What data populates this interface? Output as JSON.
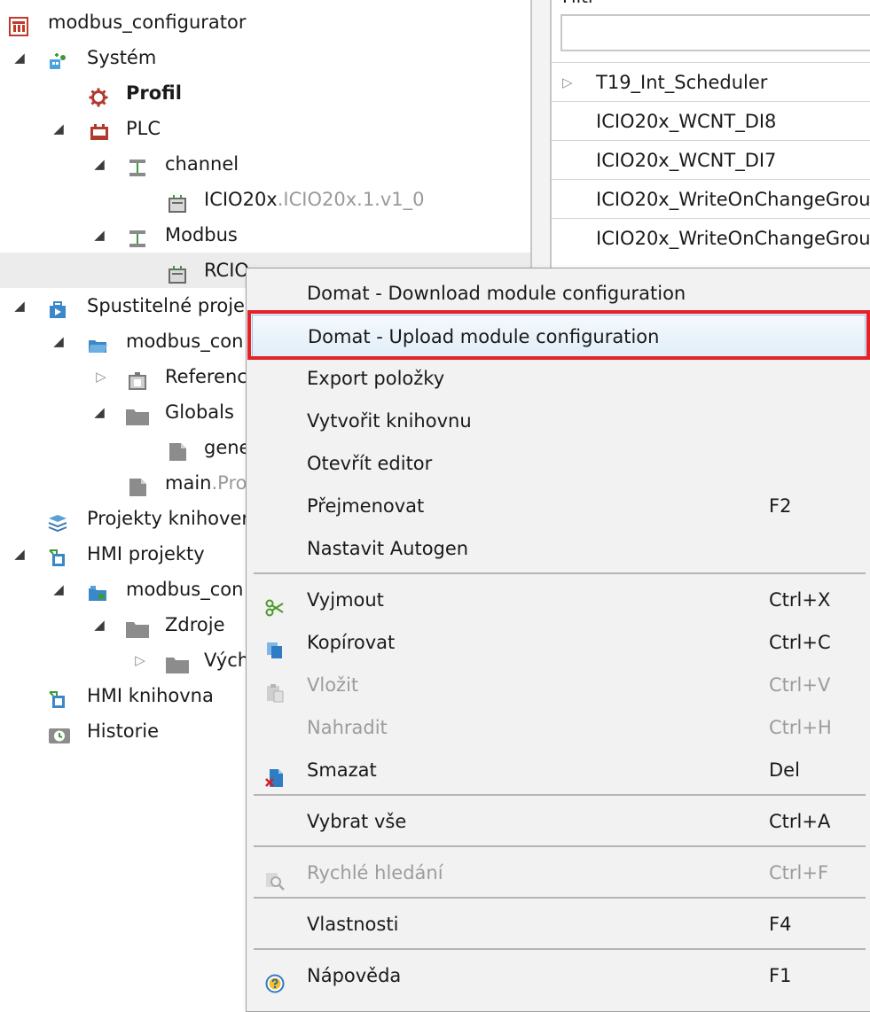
{
  "tree": {
    "items": [
      {
        "label": "modbus_configurator",
        "suffix": "",
        "bold": false,
        "icon": "project-root-icon"
      },
      {
        "label": "Systém",
        "suffix": "",
        "bold": false,
        "icon": "system-icon"
      },
      {
        "label": "Profil",
        "suffix": "",
        "bold": true,
        "icon": "gear-icon"
      },
      {
        "label": "PLC",
        "suffix": "",
        "bold": false,
        "icon": "plc-icon"
      },
      {
        "label": "channel",
        "suffix": "",
        "bold": false,
        "icon": "channel-icon"
      },
      {
        "label": "ICIO20x",
        "suffix": ".ICIO20x.1.v1_0",
        "bold": false,
        "icon": "module-icon"
      },
      {
        "label": "Modbus",
        "suffix": "",
        "bold": false,
        "icon": "channel-icon"
      },
      {
        "label": "RCIO",
        "suffix": "...",
        "bold": false,
        "icon": "module-icon"
      },
      {
        "label": "Spustitelné proje",
        "suffix": "",
        "bold": false,
        "icon": "executable-projects-icon"
      },
      {
        "label": "modbus_con",
        "suffix": "",
        "bold": false,
        "icon": "open-folder-icon"
      },
      {
        "label": "Referenc",
        "suffix": "",
        "bold": false,
        "icon": "references-icon"
      },
      {
        "label": "Globals",
        "suffix": "",
        "bold": false,
        "icon": "folder-icon"
      },
      {
        "label": "gene",
        "suffix": "",
        "bold": false,
        "icon": "file-icon"
      },
      {
        "label": "main",
        "suffix": ".Pro",
        "bold": false,
        "icon": "file-icon"
      },
      {
        "label": "Projekty knihover",
        "suffix": "",
        "bold": false,
        "icon": "library-icon"
      },
      {
        "label": "HMI projekty",
        "suffix": "",
        "bold": false,
        "icon": "hmi-icon"
      },
      {
        "label": "modbus_con",
        "suffix": "",
        "bold": false,
        "icon": "hmi-project-icon"
      },
      {
        "label": "Zdroje",
        "suffix": "",
        "bold": false,
        "icon": "folder-icon"
      },
      {
        "label": "Vých",
        "suffix": "",
        "bold": false,
        "icon": "folder-icon"
      },
      {
        "label": "HMI knihovna",
        "suffix": "",
        "bold": false,
        "icon": "hmi-icon"
      },
      {
        "label": "Historie",
        "suffix": "",
        "bold": false,
        "icon": "history-icon"
      }
    ]
  },
  "right_panel": {
    "filter_label": "Filtr",
    "filter_value": "",
    "items": [
      {
        "label": "T19_Int_Scheduler",
        "expandable": true
      },
      {
        "label": "ICIO20x_WCNT_DI8",
        "expandable": false
      },
      {
        "label": "ICIO20x_WCNT_DI7",
        "expandable": false
      },
      {
        "label": "ICIO20x_WriteOnChangeGrou",
        "expandable": false
      },
      {
        "label": "ICIO20x_WriteOnChangeGrou",
        "expandable": false
      }
    ]
  },
  "context_menu": {
    "items": [
      {
        "label": "Domat - Download module configuration",
        "shortcut": "",
        "icon": "",
        "disabled": false
      },
      {
        "label": "Domat - Upload module configuration",
        "shortcut": "",
        "icon": "",
        "disabled": false,
        "highlighted": true
      },
      {
        "label": "Export položky",
        "shortcut": "",
        "icon": "",
        "disabled": false
      },
      {
        "label": "Vytvořit knihovnu",
        "shortcut": "",
        "icon": "",
        "disabled": false
      },
      {
        "label": "Otevřít editor",
        "shortcut": "",
        "icon": "",
        "disabled": false
      },
      {
        "label": "Přejmenovat",
        "shortcut": "F2",
        "icon": "",
        "disabled": false
      },
      {
        "label": "Nastavit Autogen",
        "shortcut": "",
        "icon": "",
        "disabled": false
      },
      {
        "label": "Vyjmout",
        "shortcut": "Ctrl+X",
        "icon": "scissors-icon",
        "disabled": false
      },
      {
        "label": "Kopírovat",
        "shortcut": "Ctrl+C",
        "icon": "copy-icon",
        "disabled": false
      },
      {
        "label": "Vložit",
        "shortcut": "Ctrl+V",
        "icon": "paste-icon",
        "disabled": true
      },
      {
        "label": "Nahradit",
        "shortcut": "Ctrl+H",
        "icon": "",
        "disabled": true
      },
      {
        "label": "Smazat",
        "shortcut": "Del",
        "icon": "delete-icon",
        "disabled": false
      },
      {
        "label": "Vybrat vše",
        "shortcut": "Ctrl+A",
        "icon": "",
        "disabled": false
      },
      {
        "label": "Rychlé hledání",
        "shortcut": "Ctrl+F",
        "icon": "quick-search-icon",
        "disabled": true
      },
      {
        "label": "Vlastnosti",
        "shortcut": "F4",
        "icon": "",
        "disabled": false
      },
      {
        "label": "Nápověda",
        "shortcut": "F1",
        "icon": "help-icon",
        "disabled": false
      }
    ]
  },
  "colors": {
    "highlight_border": "#e3222a",
    "menu_background": "#f2f2f2",
    "selection_row": "#ececec"
  }
}
